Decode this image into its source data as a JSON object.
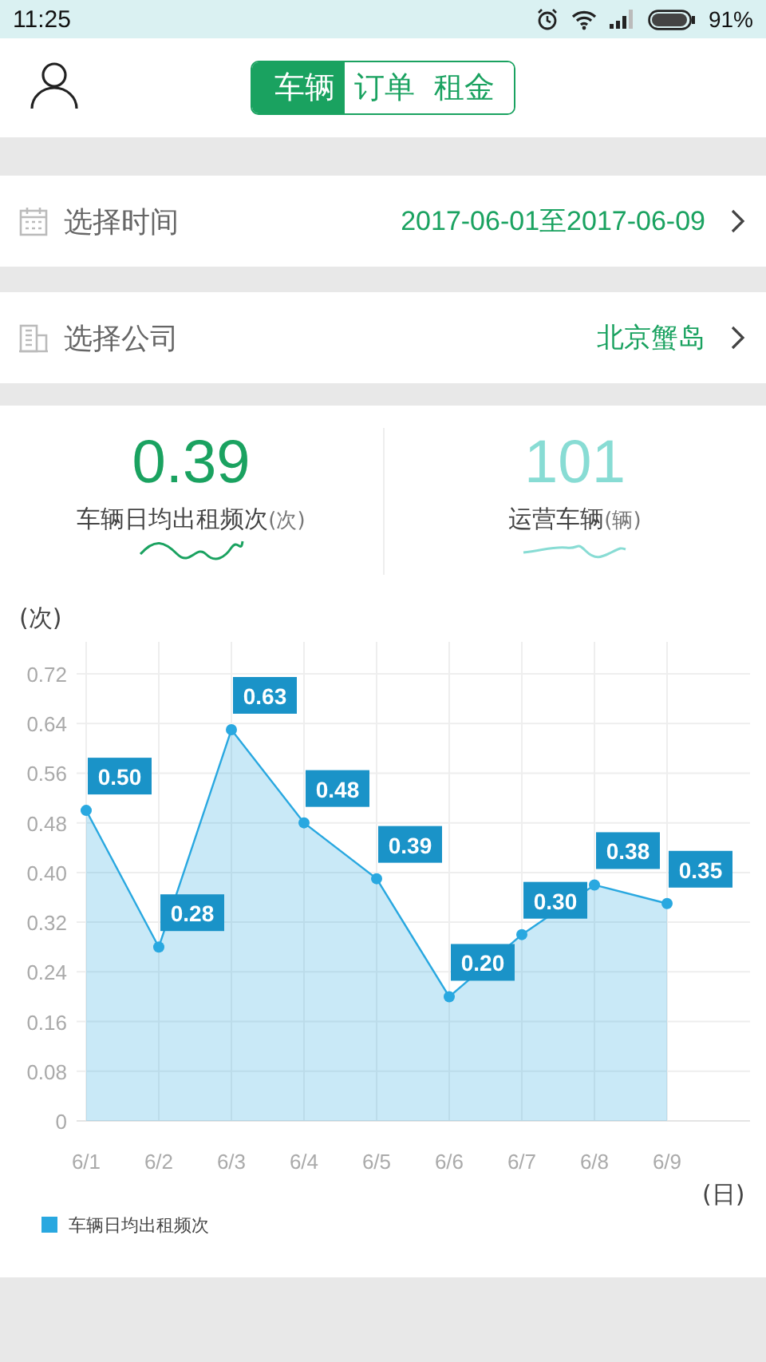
{
  "status_bar": {
    "time": "11:25",
    "battery": "91%"
  },
  "tabs": [
    {
      "label": "车辆",
      "selected": true
    },
    {
      "label": "订单",
      "selected": false
    },
    {
      "label": "租金",
      "selected": false
    }
  ],
  "filters": [
    {
      "kind": "calendar",
      "label": "选择时间",
      "value": "2017-06-01至2017-06-09"
    },
    {
      "kind": "building",
      "label": "选择公司",
      "value": "北京蟹岛"
    }
  ],
  "stats": [
    {
      "value": "0.39",
      "label": "车辆日均出租频次",
      "unit": "(次)",
      "color": "#1aa260"
    },
    {
      "value": "101",
      "label": "运营车辆",
      "unit": "(辆)",
      "color": "#88dcd4"
    }
  ],
  "chart": {
    "chart_data": {
      "type": "area",
      "xlabel": "(日)",
      "ylabel": "(次)",
      "categories": [
        "6/1",
        "6/2",
        "6/3",
        "6/4",
        "6/5",
        "6/6",
        "6/7",
        "6/8",
        "6/9"
      ],
      "series": [
        {
          "name": "车辆日均出租频次",
          "color": "#29a8e0",
          "values": [
            0.5,
            0.28,
            0.63,
            0.48,
            0.39,
            0.2,
            0.3,
            0.38,
            0.35
          ]
        }
      ],
      "ylim": [
        0,
        0.72
      ],
      "yticks": [
        0,
        0.08,
        0.16,
        0.24,
        0.32,
        {
          "value": 0.4,
          "label": "0.40"
        },
        0.48,
        0.56,
        0.64,
        0.72
      ],
      "grid": true,
      "value_labels": [
        "0.50",
        "0.28",
        "0.63",
        "0.48",
        "0.39",
        "0.20",
        "0.30",
        "0.38",
        "0.35"
      ]
    }
  }
}
